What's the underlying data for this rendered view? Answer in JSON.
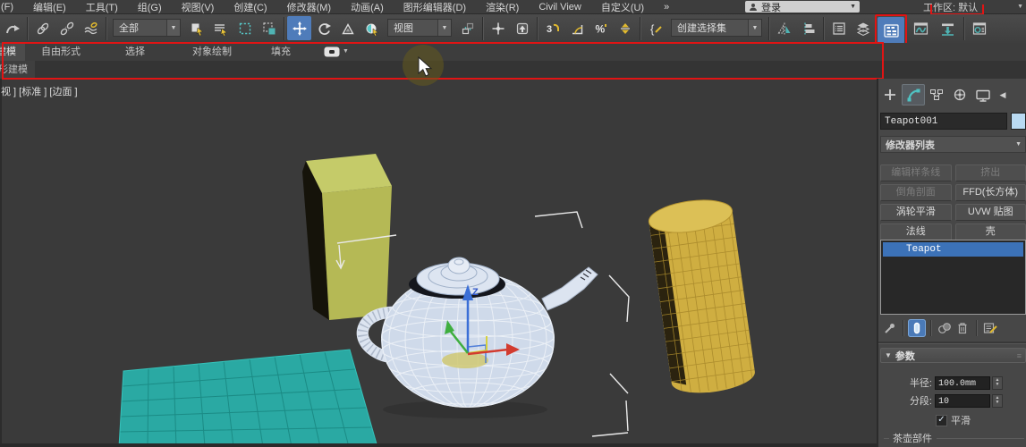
{
  "annotation": {
    "color": "#e11414"
  },
  "menubar": {
    "items": [
      "(F)",
      "编辑(E)",
      "工具(T)",
      "组(G)",
      "视图(V)",
      "创建(C)",
      "修改器(M)",
      "动画(A)",
      "图形编辑器(D)",
      "渲染(R)",
      "Civil View",
      "自定义(U)",
      "»"
    ],
    "login_label": "登录",
    "workspace_label": "工作区: 默认"
  },
  "toolbar": {
    "filter_value": "全部",
    "coord_value": "视图",
    "selection_set_value": "创建选择集",
    "highlight_color": "#4f7cba",
    "icons": [
      "redo-icon",
      "link-icon",
      "unlink-icon",
      "bind-spacewarp-icon",
      "select-object-icon",
      "select-by-name-icon",
      "rect-region-icon",
      "window-crossing-icon",
      "move-icon",
      "rotate-icon",
      "scale-icon",
      "select-manipulate-icon",
      "pivot-center-icon",
      "select-place-icon",
      "keyboard-override-icon",
      "snap-3d-icon",
      "angle-snap-icon",
      "percent-snap-icon",
      "spinner-snap-icon",
      "named-sets-icon",
      "mirror-icon",
      "align-icon",
      "scene-explorer-icon",
      "layer-explorer-icon",
      "ribbon-toggle-icon",
      "curve-editor-icon",
      "schematic-view-icon",
      "render-setup-icon"
    ]
  },
  "ribbon": {
    "tabs": [
      "建模",
      "自由形式",
      "选择",
      "对象绘制",
      "填充"
    ],
    "active_tab": "建模",
    "panel_tab_label": "形建模"
  },
  "viewport": {
    "label": "视 ] [标准 ] [边面 ]",
    "gizmo_z_label": "Z",
    "objects": {
      "plane_fill": "#2aa9a3",
      "plane_grid": "#1b8b85",
      "box_fill": "#b5b955",
      "box_top_fill": "#c5cb69",
      "box_dark_fill": "#15130a",
      "cylinder_fill": "#cfae41",
      "cylinder_top_fill": "#dcc056",
      "teapot_fill": "#cfdaea",
      "wire_color": "#eef2f8"
    }
  },
  "command_panel": {
    "tabs": [
      "tab-create",
      "tab-modify",
      "tab-hierarchy",
      "tab-motion",
      "tab-display"
    ],
    "active_tab": "tab-modify",
    "object_name": "Teapot001",
    "object_color": "#b9daf2",
    "modifier_list_label": "修改器列表",
    "modifier_buttons": [
      {
        "label": "编辑样条线",
        "enabled": false
      },
      {
        "label": "挤出",
        "enabled": false
      },
      {
        "label": "倒角剖面",
        "enabled": false
      },
      {
        "label": "FFD(长方体)",
        "enabled": true
      },
      {
        "label": "涡轮平滑",
        "enabled": true
      },
      {
        "label": "UVW 贴图",
        "enabled": true
      },
      {
        "label": "法线",
        "enabled": true
      },
      {
        "label": "壳",
        "enabled": true
      }
    ],
    "stack_items": [
      {
        "label": "Teapot",
        "selected": true
      }
    ],
    "stack_selected_color": "#3c72b8",
    "parameters": {
      "title": "参数",
      "radius_label": "半径:",
      "radius_value": "100.0mm",
      "segments_label": "分段:",
      "segments_value": "10",
      "smooth_label": "平滑",
      "smooth_checked": true,
      "group_label": "茶壶部件"
    }
  }
}
